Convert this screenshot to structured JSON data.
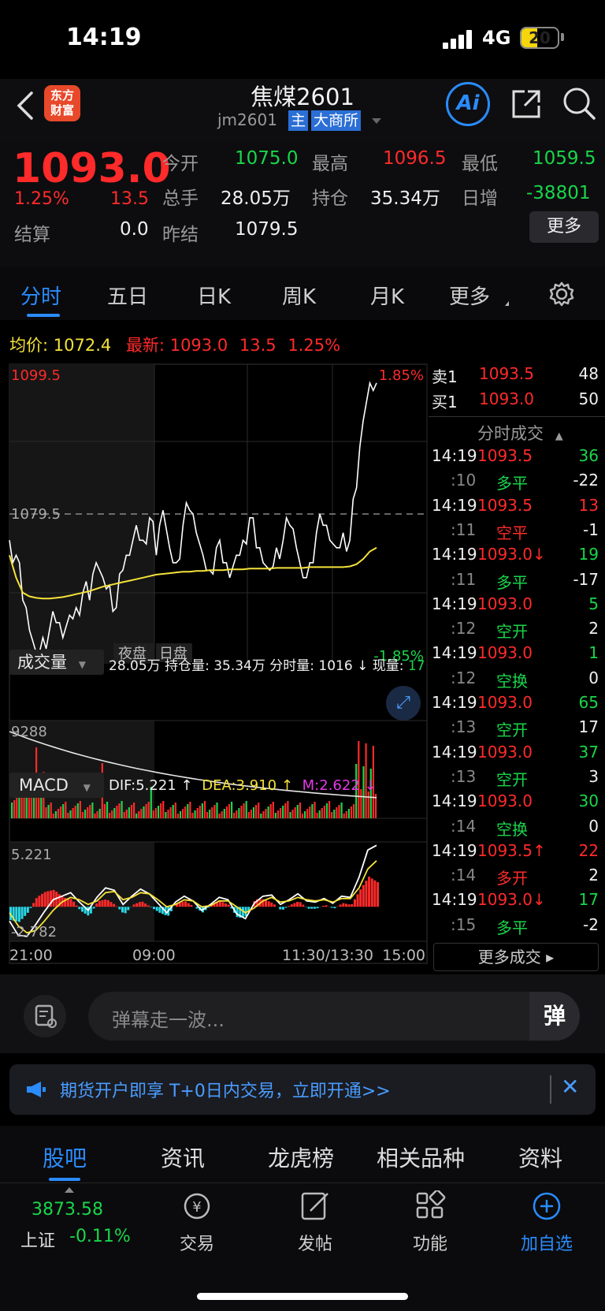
{
  "status": {
    "time": "14:19",
    "network": "4G",
    "battery": "20"
  },
  "nav": {
    "logo_line1": "东方",
    "logo_line2": "财富",
    "title": "焦煤2601",
    "code": "jm2601",
    "badge_main": "主",
    "badge_exchange": "大商所"
  },
  "quote": {
    "price": "1093.0",
    "pct": "1.25%",
    "change": "13.5",
    "open_label": "今开",
    "open": "1075.0",
    "high_label": "最高",
    "high": "1096.5",
    "low_label": "最低",
    "low": "1059.5",
    "volume_label": "总手",
    "volume": "28.05万",
    "oi_label": "持仓",
    "oi": "35.34万",
    "oi_change_label": "日增",
    "oi_change": "-38801",
    "settle_label": "结算",
    "settle": "0.0",
    "prev_settle_label": "昨结",
    "prev_settle": "1079.5",
    "more_btn": "更多"
  },
  "tabs": [
    "分时",
    "五日",
    "日K",
    "周K",
    "月K",
    "更多"
  ],
  "info_line": {
    "avg_label": "均价:",
    "avg": "1072.4",
    "last_label": "最新:",
    "last": "1093.0",
    "chg": "13.5",
    "pct": "1.25%"
  },
  "chart_data": [
    {
      "type": "line",
      "title": "",
      "ylim": [
        1059.5,
        1099.5
      ],
      "y_tick_labels": [
        "1099.5",
        "1079.5",
        "1059.5"
      ],
      "right_tick_labels": [
        "1.85%",
        "-1.85%"
      ],
      "x_tick_labels": [
        "21:00",
        "09:00",
        "11:30/13:30",
        "15:00"
      ],
      "session_labels": [
        "夜盘",
        "日盘"
      ],
      "reference_line": 1079.5,
      "series": [
        {
          "values": [
            1076,
            1074,
            1068,
            1064,
            1061,
            1063,
            1064,
            1065,
            1063,
            1066,
            1067,
            1069,
            1068,
            1073,
            1071,
            1070,
            1067,
            1072,
            1074,
            1078,
            1076,
            1079,
            1074,
            1080,
            1075,
            1073,
            1078,
            1080,
            1077,
            1074,
            1072,
            1075,
            1073,
            1071,
            1074,
            1076,
            1079,
            1075,
            1073,
            1072,
            1075,
            1076,
            1078,
            1075,
            1071,
            1073,
            1077,
            1078,
            1076,
            1075,
            1077,
            1076,
            1083,
            1092,
            1097,
            1097
          ]
        },
        {
          "values": [
            1074,
            1071,
            1069,
            1068.5,
            1068.3,
            1068.2,
            1068.2,
            1068.3,
            1068.4,
            1068.6,
            1068.8,
            1069,
            1069.2,
            1069.5,
            1069.8,
            1070,
            1070.2,
            1070.4,
            1070.6,
            1070.8,
            1071,
            1071.2,
            1071.4,
            1071.5,
            1071.6,
            1071.7,
            1071.8,
            1071.8,
            1071.9,
            1071.9,
            1072,
            1072,
            1072,
            1072.1,
            1072.1,
            1072.1,
            1072.2,
            1072.2,
            1072.2,
            1072.2,
            1072.3,
            1072.3,
            1072.3,
            1072.3,
            1072.3,
            1072.4,
            1072.4,
            1072.4,
            1072.4,
            1072.4,
            1072.4,
            1072.5,
            1072.8,
            1073.5,
            1074.5,
            1075
          ]
        }
      ]
    },
    {
      "type": "bar",
      "title": "",
      "ymax_label": "9288",
      "note": "volume"
    },
    {
      "type": "bar",
      "title": "",
      "ylim": [
        -2.782,
        5.221
      ],
      "y_tick_labels": [
        "5.221",
        "-2.782"
      ],
      "series": [
        {
          "values": [
            -1.2,
            -2.4,
            -2.5,
            -1.5,
            -0.4,
            0.6,
            0.9,
            1.2,
            0.4,
            -0.3,
            0.8,
            1.6,
            1.4,
            0.2,
            0.9,
            1.5,
            1.1,
            0.3,
            -0.5,
            0.4,
            0.9,
            0.5,
            -0.3,
            0.2,
            0.8,
            0.6,
            -0.6,
            -1.0,
            0.3,
            0.9,
            1.0,
            0.2,
            0.6,
            1.1,
            0.5,
            0.4,
            0.7,
            0.3,
            0.9,
            0.8,
            2.5,
            4.8,
            5.2
          ]
        },
        {
          "values": [
            -0.5,
            -1.6,
            -2.2,
            -2.0,
            -1.2,
            -0.3,
            0.4,
            0.8,
            0.6,
            0.2,
            0.5,
            1.2,
            1.3,
            0.6,
            0.8,
            1.2,
            1.1,
            0.6,
            0.0,
            0.2,
            0.6,
            0.5,
            0.0,
            0.1,
            0.5,
            0.5,
            0.0,
            -0.5,
            -0.1,
            0.5,
            0.8,
            0.4,
            0.5,
            0.8,
            0.6,
            0.5,
            0.6,
            0.4,
            0.7,
            0.7,
            1.6,
            3.2,
            3.9
          ]
        }
      ]
    }
  ],
  "volume_header": {
    "label": "成交量",
    "text": "28.05万 持仓量: 35.34万 分时量: 1016",
    "now_label": "现量:",
    "now": "17"
  },
  "macd_header": {
    "label": "MACD",
    "dif": "DIF:5.221 ↑",
    "dea": "DEA:3.910 ↑",
    "m": "M:2.622 ↓"
  },
  "orderbook": [
    {
      "side": "卖1",
      "price": "1093.5",
      "qty": "48"
    },
    {
      "side": "买1",
      "price": "1093.0",
      "qty": "50"
    }
  ],
  "ticks_header": "分时成交",
  "ticks": [
    {
      "t": "14:19",
      "p": "1093.5",
      "q": "36",
      "pc": "red",
      "qc": "green"
    },
    {
      "t": ":10",
      "p": "多平",
      "q": "-22",
      "pc": "green",
      "qc": "white"
    },
    {
      "t": "14:19",
      "p": "1093.5",
      "q": "13",
      "pc": "red",
      "qc": "red"
    },
    {
      "t": ":11",
      "p": "空平",
      "q": "-1",
      "pc": "red",
      "qc": "white"
    },
    {
      "t": "14:19",
      "p": "1093.0↓",
      "q": "19",
      "pc": "red",
      "qc": "green"
    },
    {
      "t": ":11",
      "p": "多平",
      "q": "-17",
      "pc": "green",
      "qc": "white"
    },
    {
      "t": "14:19",
      "p": "1093.0",
      "q": "5",
      "pc": "red",
      "qc": "green"
    },
    {
      "t": ":12",
      "p": "空开",
      "q": "2",
      "pc": "green",
      "qc": "white"
    },
    {
      "t": "14:19",
      "p": "1093.0",
      "q": "1",
      "pc": "red",
      "qc": "green"
    },
    {
      "t": ":12",
      "p": "空换",
      "q": "0",
      "pc": "green",
      "qc": "white"
    },
    {
      "t": "14:19",
      "p": "1093.0",
      "q": "65",
      "pc": "red",
      "qc": "green"
    },
    {
      "t": ":13",
      "p": "空开",
      "q": "17",
      "pc": "green",
      "qc": "white"
    },
    {
      "t": "14:19",
      "p": "1093.0",
      "q": "37",
      "pc": "red",
      "qc": "green"
    },
    {
      "t": ":13",
      "p": "空开",
      "q": "3",
      "pc": "green",
      "qc": "white"
    },
    {
      "t": "14:19",
      "p": "1093.0",
      "q": "30",
      "pc": "red",
      "qc": "green"
    },
    {
      "t": ":14",
      "p": "空换",
      "q": "0",
      "pc": "green",
      "qc": "white"
    },
    {
      "t": "14:19",
      "p": "1093.5↑",
      "q": "22",
      "pc": "red",
      "qc": "red"
    },
    {
      "t": ":14",
      "p": "多开",
      "q": "2",
      "pc": "red",
      "qc": "white"
    },
    {
      "t": "14:19",
      "p": "1093.0↓",
      "q": "17",
      "pc": "red",
      "qc": "green"
    },
    {
      "t": ":15",
      "p": "多平",
      "q": "-2",
      "pc": "green",
      "qc": "white"
    }
  ],
  "more_ticks": "更多成交 ▸",
  "input": {
    "placeholder": "弹幕走一波...",
    "send": "弹"
  },
  "banner": {
    "text": "期货开户即享 T+0日内交易，立即开通>>"
  },
  "bottom_tabs": [
    "股吧",
    "资讯",
    "龙虎榜",
    "相关品种",
    "资料"
  ],
  "toolbar": {
    "index_value": "3873.58",
    "index_name": "上证",
    "index_pct": "-0.11%",
    "trade": "交易",
    "post": "发帖",
    "func": "功能",
    "add": "加自选"
  },
  "colors": {
    "up": "#ff2a2a",
    "down": "#19d64a",
    "accent": "#2a8cff",
    "avg": "#f5e23a"
  }
}
